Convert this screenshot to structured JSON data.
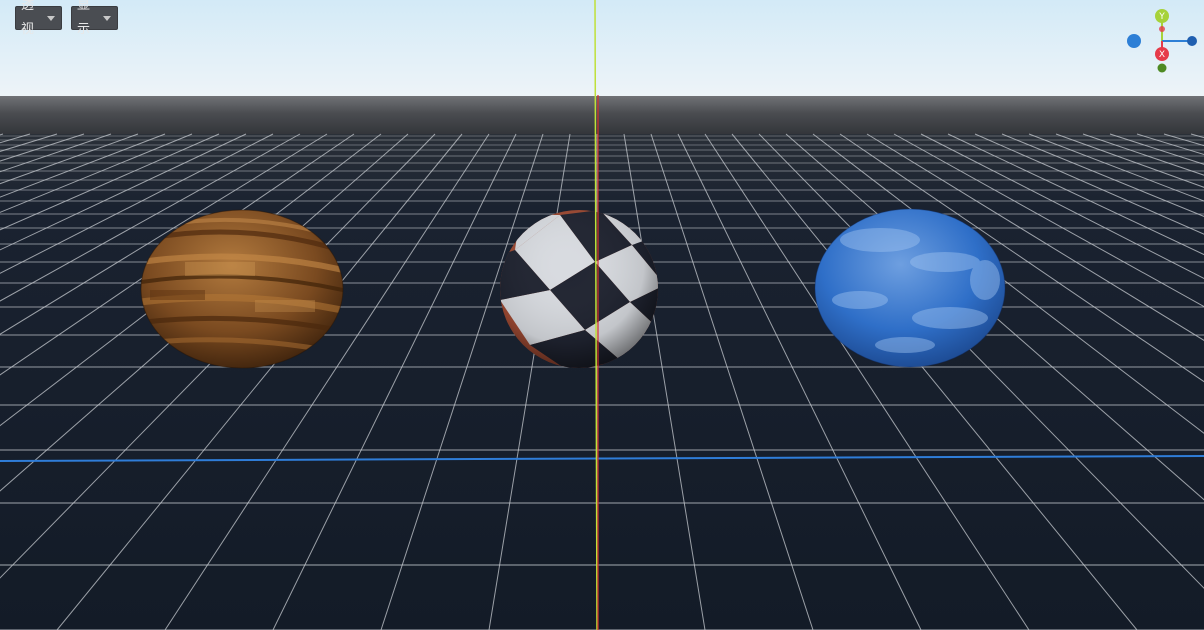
{
  "toolbar": {
    "view_label": "透视",
    "display_label": "显示"
  },
  "gizmo": {
    "y_label": "Y",
    "x_label": "X",
    "colors": {
      "x": "#e63b4a",
      "y": "#a6d23a",
      "z": "#2d7fd6"
    }
  },
  "scene": {
    "sky_top": "#d3eaf7",
    "sky_bottom": "#ecf3f8",
    "horizon": "#6a6c70",
    "floor": "#152030",
    "grid_line": "#c8ccd2",
    "axis_vertical": "#d9e84a",
    "axis_red": "#d6322d",
    "axis_blue": "#2f7dd8",
    "spheres": [
      {
        "name": "wood",
        "colors": [
          "#8a5626",
          "#5e3513",
          "#b27a3e"
        ]
      },
      {
        "name": "checker",
        "colors": [
          "#9e4a33",
          "#1f2330",
          "#d8dbe0"
        ]
      },
      {
        "name": "water",
        "colors": [
          "#2f6fc8",
          "#8bb6ea",
          "#1e4d9a"
        ]
      }
    ]
  }
}
